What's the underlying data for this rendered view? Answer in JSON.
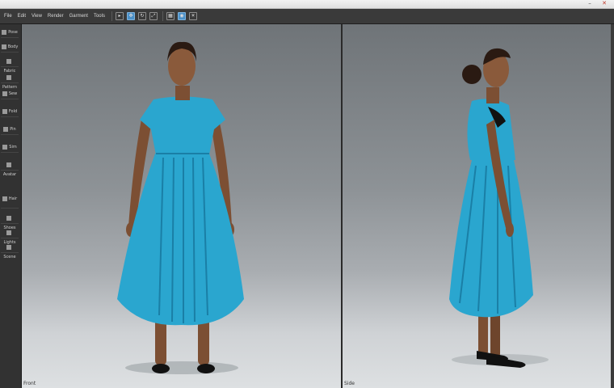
{
  "window": {
    "minimize_glyph": "–",
    "close_glyph": "✕"
  },
  "toolbar": {
    "menus": [
      "File",
      "Edit",
      "View",
      "Render",
      "Garment",
      "Tools"
    ],
    "icons": [
      "select-icon",
      "move-icon",
      "rotate-icon",
      "scale-icon",
      "cloth-icon",
      "camera-icon",
      "light-icon"
    ]
  },
  "left_panel": {
    "tools": [
      "Pose",
      "Body",
      "Fabric",
      "Pattern",
      "Sew",
      "Fold",
      "Pin",
      "Sim",
      "Avatar",
      "Hair",
      "Shoes",
      "Lights",
      "Scene"
    ]
  },
  "viewports": {
    "front_label": "Front",
    "side_label": "Side"
  },
  "colors": {
    "dress": "#2aa6cf",
    "dress_shadow": "#1a7fa6",
    "skin": "#8a5a3b",
    "hair": "#2a1a12",
    "shoes": "#111111"
  }
}
